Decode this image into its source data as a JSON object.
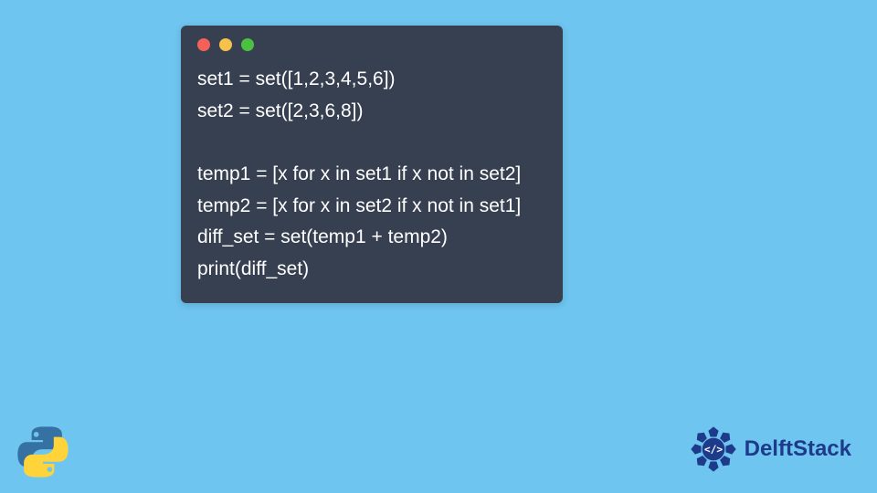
{
  "code": {
    "lines": [
      "set1 = set([1,2,3,4,5,6])",
      "set2 = set([2,3,6,8])",
      "",
      "temp1 = [x for x in set1 if x not in set2]",
      "temp2 = [x for x in set2 if x not in set1]",
      "diff_set = set(temp1 + temp2)",
      "print(diff_set)"
    ]
  },
  "brand": {
    "name": "DelftStack"
  },
  "colors": {
    "background": "#6ec5ef",
    "window": "#374050",
    "red": "#f3615a",
    "yellow": "#f6c24b",
    "green": "#4cc040",
    "brandBlue": "#1e3a8a"
  }
}
